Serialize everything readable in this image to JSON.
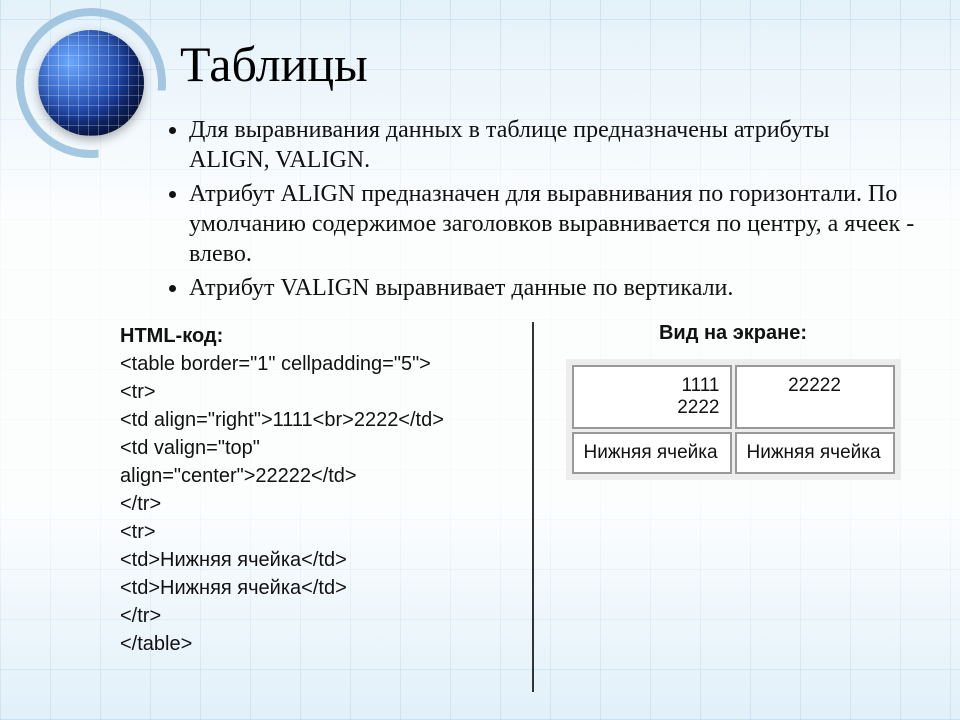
{
  "title": "Таблицы",
  "bullets": {
    "b1": "Для выравнивания данных в таблице предназначены атрибуты ALIGN, VALIGN.",
    "b2": "Атрибут ALIGN предназначен для выравнивания по горизонтали. По умолчанию содержимое заголовков выравнивается по центру, а ячеек - влево.",
    "b3": "Атрибут VALIGN выравнивает данные по вертикали."
  },
  "left": {
    "header": "HTML-код:",
    "l1": "<table border=\"1\" cellpadding=\"5\">",
    "l2": " <tr>",
    "l3": "  <td align=\"right\">1111<br>2222</td>",
    "l4": "  <td valign=\"top\"",
    "l5": "align=\"center\">22222</td>",
    "l6": " </tr>",
    "l7": " <tr>",
    "l8": "  <td>Нижняя ячейка</td>",
    "l9": "  <td>Нижняя ячейка</td>",
    "l10": " </tr>",
    "l11": " </table>"
  },
  "right": {
    "header": "Вид на экране:"
  },
  "chart_data": {
    "type": "table",
    "rows": [
      {
        "cells": [
          {
            "value_line1": "1111",
            "value_line2": "2222",
            "align": "right"
          },
          {
            "value": "22222",
            "align": "center",
            "valign": "top"
          }
        ]
      },
      {
        "cells": [
          {
            "value": "Нижняя ячейка"
          },
          {
            "value": "Нижняя ячейка"
          }
        ]
      }
    ]
  }
}
